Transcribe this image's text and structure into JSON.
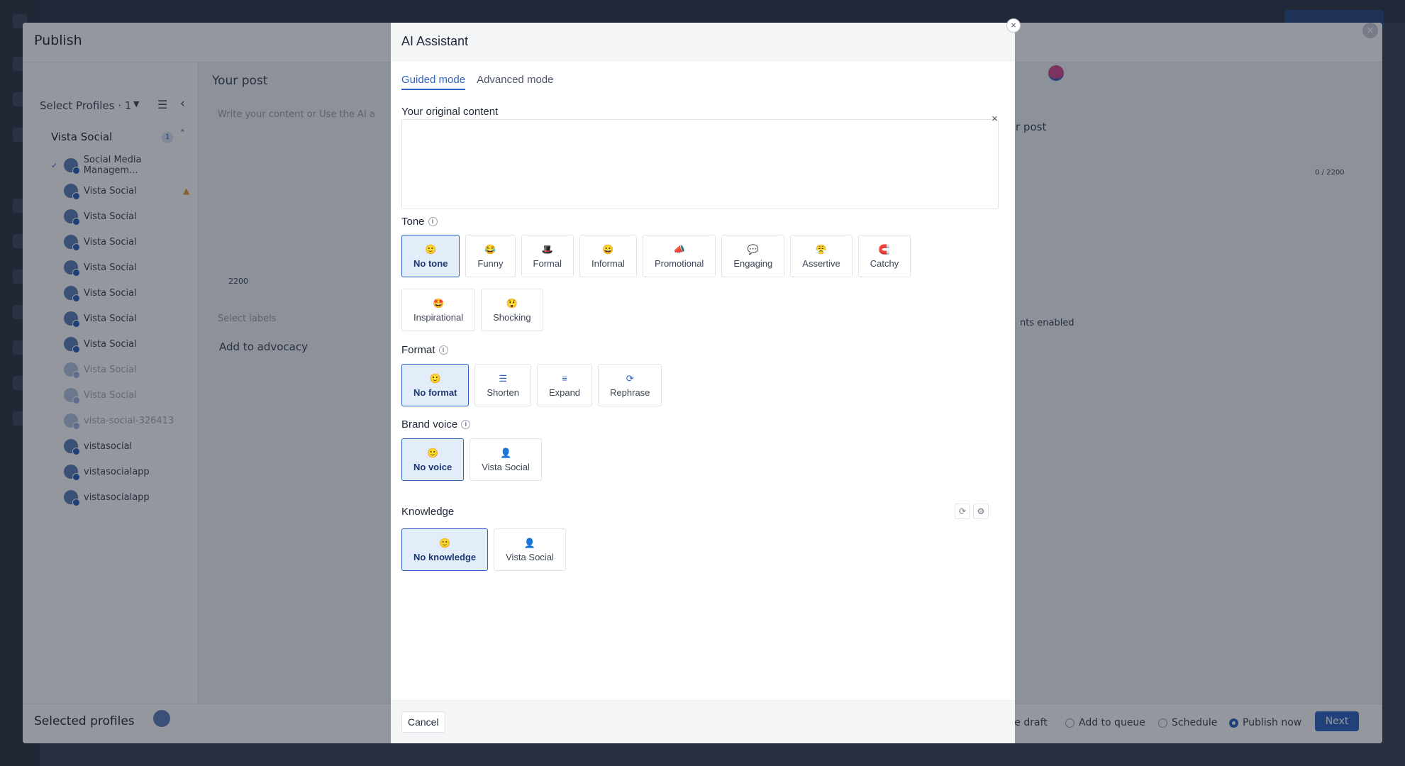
{
  "background": {
    "panel_title": "Publish",
    "select_profiles": "Select Profiles · 1",
    "group_name": "Vista Social",
    "group_count": "1",
    "profiles": [
      {
        "name": "Social Media Managem..."
      },
      {
        "name": "Vista Social"
      },
      {
        "name": "Vista Social"
      },
      {
        "name": "Vista Social"
      },
      {
        "name": "Vista Social"
      },
      {
        "name": "Vista Social"
      },
      {
        "name": "Vista Social"
      },
      {
        "name": "Vista Social"
      },
      {
        "name": "Vista Social"
      },
      {
        "name": "Vista Social"
      },
      {
        "name": "vista-social-326413"
      },
      {
        "name": "vistasocial"
      },
      {
        "name": "vistasocialapp"
      },
      {
        "name": "vistasocialapp"
      }
    ],
    "post_title": "Your post",
    "post_hint": "Write your content or    Use the AI a",
    "char_count": "2200",
    "select_labels": "Select labels",
    "add_to_advocacy": "Add to advocacy",
    "preview_title": "r post",
    "preview_counter": "0 / 2200",
    "comments_enabled": "nts enabled",
    "footer_label": "Selected profiles",
    "footer_options": [
      {
        "label": "ve draft"
      },
      {
        "label": "Add to queue"
      },
      {
        "label": "Schedule"
      },
      {
        "label": "Publish now"
      }
    ],
    "next_label": "Next"
  },
  "modal": {
    "title": "AI Assistant",
    "close_icon": "×",
    "tabs": [
      {
        "label": "Guided mode",
        "active": true
      },
      {
        "label": "Advanced mode",
        "active": false
      }
    ],
    "original_content_label": "Your original content",
    "original_content_value": "",
    "clear_icon": "×",
    "mic_icon": "🎙",
    "collapse_icon": "˄",
    "tone": {
      "label": "Tone",
      "options": [
        {
          "label": "No tone",
          "icon": "🙂",
          "selected": true
        },
        {
          "label": "Funny",
          "icon": "😂",
          "selected": false
        },
        {
          "label": "Formal",
          "icon": "🎩",
          "selected": false
        },
        {
          "label": "Informal",
          "icon": "😀",
          "selected": false
        },
        {
          "label": "Promotional",
          "icon": "📣",
          "selected": false
        },
        {
          "label": "Engaging",
          "icon": "💬",
          "selected": false
        },
        {
          "label": "Assertive",
          "icon": "😤",
          "selected": false
        },
        {
          "label": "Catchy",
          "icon": "🧲",
          "selected": false
        },
        {
          "label": "Inspirational",
          "icon": "🤩",
          "selected": false
        },
        {
          "label": "Shocking",
          "icon": "😲",
          "selected": false
        }
      ]
    },
    "format": {
      "label": "Format",
      "options": [
        {
          "label": "No format",
          "icon": "🙂",
          "selected": true
        },
        {
          "label": "Shorten",
          "icon": "☰",
          "selected": false
        },
        {
          "label": "Expand",
          "icon": "≡",
          "selected": false
        },
        {
          "label": "Rephrase",
          "icon": "⟳",
          "selected": false
        }
      ]
    },
    "brand_voice": {
      "label": "Brand voice",
      "options": [
        {
          "label": "No voice",
          "icon": "🙂",
          "selected": true
        },
        {
          "label": "Vista Social",
          "icon": "👤",
          "selected": false
        }
      ]
    },
    "knowledge": {
      "label": "Knowledge",
      "refresh_icon": "⟳",
      "settings_icon": "⚙",
      "options": [
        {
          "label": "No knowledge",
          "icon": "🙂",
          "selected": true
        },
        {
          "label": "Vista Social",
          "icon": "👤",
          "selected": false
        }
      ]
    },
    "cancel_label": "Cancel"
  },
  "colors": {
    "accent": "#2f63c0",
    "selected_chip_bg": "#e3ecf9",
    "overlay": "#11182773"
  }
}
